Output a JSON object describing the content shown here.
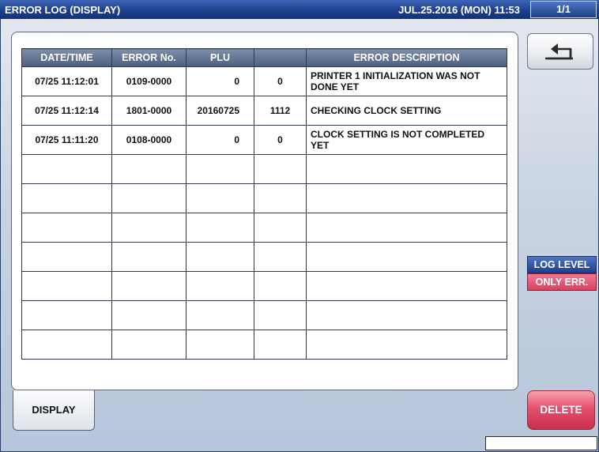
{
  "window": {
    "title": "ERROR LOG (DISPLAY)",
    "datetime": "JUL.25.2016 (MON)  11:53",
    "page": "1/1"
  },
  "table": {
    "headers": [
      "DATE/TIME",
      "ERROR No.",
      "PLU",
      "",
      "ERROR DESCRIPTION"
    ],
    "rows": [
      {
        "datetime": "07/25 11:12:01",
        "error_no": "0109-0000",
        "plu": "0",
        "code": "0",
        "description": "PRINTER 1 INITIALIZATION WAS NOT DONE YET"
      },
      {
        "datetime": "07/25 11:12:14",
        "error_no": "1801-0000",
        "plu": "20160725",
        "code": "1112",
        "description": "CHECKING CLOCK SETTING"
      },
      {
        "datetime": "07/25 11:11:20",
        "error_no": "0108-0000",
        "plu": "0",
        "code": "0",
        "description": "CLOCK SETTING IS NOT COMPLETED YET"
      }
    ],
    "empty_rows": 7
  },
  "tabs": {
    "display_label": "DISPLAY"
  },
  "side": {
    "return_icon": "return-arrow-icon",
    "log_level_label": "LOG LEVEL",
    "log_level_value": "ONLY ERR.",
    "delete_label": "DELETE"
  },
  "colors": {
    "titlebar": "#1d3f8d",
    "log_level_bg": "#1e3f8c",
    "only_err_bg": "#d9405f",
    "delete_bg": "#e5506d"
  }
}
